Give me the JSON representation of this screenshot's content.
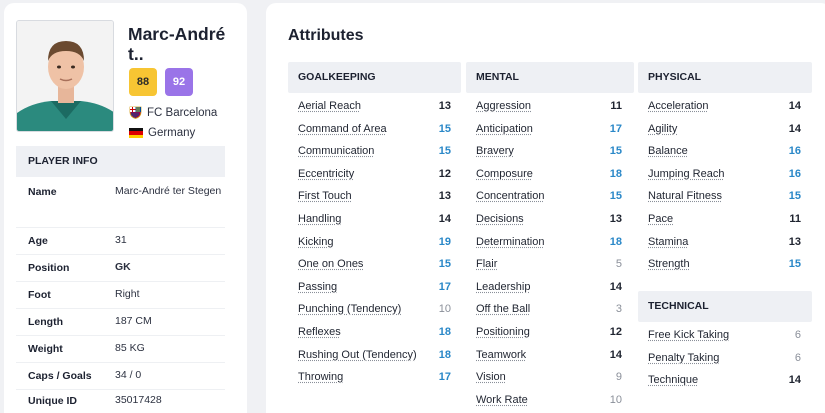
{
  "player": {
    "name_display": "Marc-André t..",
    "current_ability": "88",
    "potential_ability": "92",
    "club": "FC Barcelona",
    "nation": "Germany"
  },
  "player_info": {
    "heading": "PLAYER INFO",
    "rows": [
      {
        "key": "Name",
        "value": "Marc-André ter Stegen"
      },
      {
        "key": "Age",
        "value": "31"
      },
      {
        "key": "Position",
        "value": "GK"
      },
      {
        "key": "Foot",
        "value": "Right"
      },
      {
        "key": "Length",
        "value": "187 CM"
      },
      {
        "key": "Weight",
        "value": "85 KG"
      },
      {
        "key": "Caps / Goals",
        "value": "34 / 0"
      },
      {
        "key": "Unique ID",
        "value": "35017428"
      }
    ]
  },
  "attributes": {
    "title": "Attributes",
    "colors": {
      "high": "#1f2430",
      "very_high": "#2a88c8",
      "low": "#8a8f99"
    },
    "goalkeeping": {
      "heading": "GOALKEEPING",
      "items": [
        {
          "label": "Aerial Reach",
          "value": "13"
        },
        {
          "label": "Command of Area",
          "value": "15"
        },
        {
          "label": "Communication",
          "value": "15"
        },
        {
          "label": "Eccentricity",
          "value": "12"
        },
        {
          "label": "First Touch",
          "value": "13"
        },
        {
          "label": "Handling",
          "value": "14"
        },
        {
          "label": "Kicking",
          "value": "19"
        },
        {
          "label": "One on Ones",
          "value": "15"
        },
        {
          "label": "Passing",
          "value": "17"
        },
        {
          "label": "Punching (Tendency)",
          "value": "10"
        },
        {
          "label": "Reflexes",
          "value": "18"
        },
        {
          "label": "Rushing Out (Tendency)",
          "value": "18"
        },
        {
          "label": "Throwing",
          "value": "17"
        }
      ]
    },
    "mental": {
      "heading": "MENTAL",
      "items": [
        {
          "label": "Aggression",
          "value": "11"
        },
        {
          "label": "Anticipation",
          "value": "17"
        },
        {
          "label": "Bravery",
          "value": "15"
        },
        {
          "label": "Composure",
          "value": "18"
        },
        {
          "label": "Concentration",
          "value": "15"
        },
        {
          "label": "Decisions",
          "value": "13"
        },
        {
          "label": "Determination",
          "value": "18"
        },
        {
          "label": "Flair",
          "value": "5"
        },
        {
          "label": "Leadership",
          "value": "14"
        },
        {
          "label": "Off the Ball",
          "value": "3"
        },
        {
          "label": "Positioning",
          "value": "12"
        },
        {
          "label": "Teamwork",
          "value": "14"
        },
        {
          "label": "Vision",
          "value": "9"
        },
        {
          "label": "Work Rate",
          "value": "10"
        }
      ]
    },
    "physical": {
      "heading": "PHYSICAL",
      "items": [
        {
          "label": "Acceleration",
          "value": "14"
        },
        {
          "label": "Agility",
          "value": "14"
        },
        {
          "label": "Balance",
          "value": "16"
        },
        {
          "label": "Jumping Reach",
          "value": "16"
        },
        {
          "label": "Natural Fitness",
          "value": "15"
        },
        {
          "label": "Pace",
          "value": "11"
        },
        {
          "label": "Stamina",
          "value": "13"
        },
        {
          "label": "Strength",
          "value": "15"
        }
      ]
    },
    "technical": {
      "heading": "TECHNICAL",
      "items": [
        {
          "label": "Free Kick Taking",
          "value": "6"
        },
        {
          "label": "Penalty Taking",
          "value": "6"
        },
        {
          "label": "Technique",
          "value": "14"
        }
      ]
    }
  }
}
